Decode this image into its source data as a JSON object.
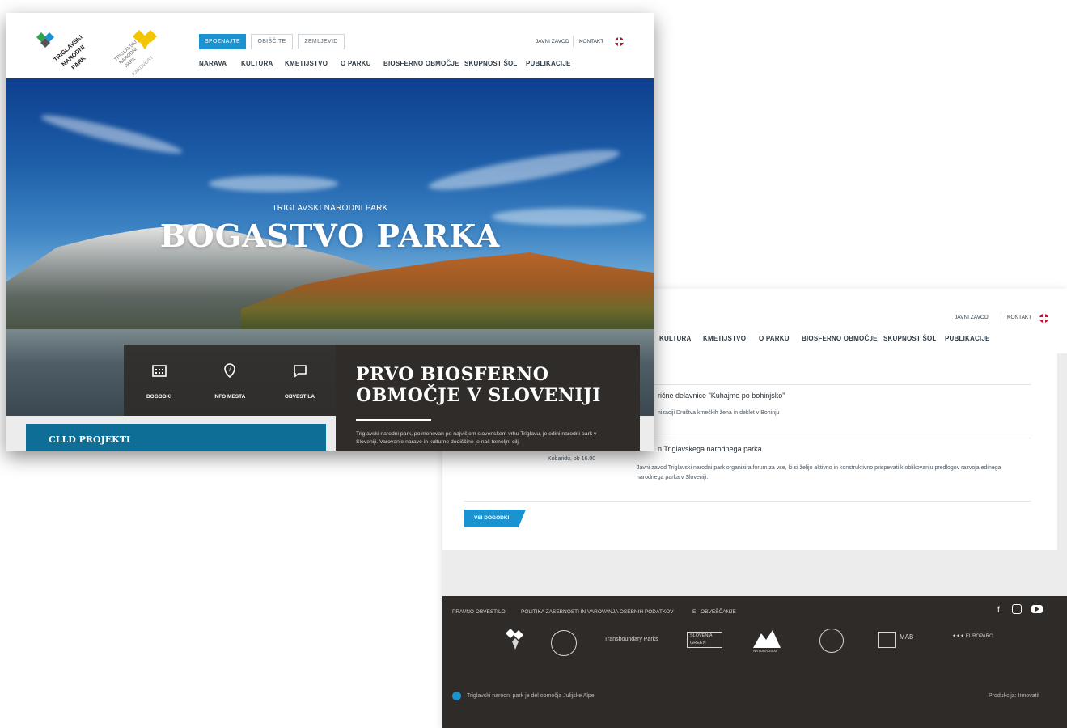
{
  "header": {
    "tabs": [
      "SPOZNAJTE",
      "OBIŠČITE",
      "ZEMLJEVID"
    ],
    "nav": [
      "NARAVA",
      "KULTURA",
      "KMETIJSTVO",
      "O PARKU",
      "BIOSFERNO OBMOČJE",
      "SKUPNOST ŠOL",
      "PUBLIKACIJE"
    ],
    "back_nav": [
      "KULTURA",
      "KMETIJSTVO",
      "O PARKU",
      "BIOSFERNO OBMOČJE",
      "SKUPNOST ŠOL",
      "PUBLIKACIJE"
    ],
    "top_links": [
      "JAVNI ZAVOD",
      "KONTAKT"
    ],
    "logo_lines": [
      "TRIGLAVSKI",
      "NARODNI",
      "PARK"
    ],
    "logo2_lines": [
      "TRIGLAVSKI",
      "NARODNI",
      "PARK",
      "KAKOVOST"
    ]
  },
  "hero": {
    "subtitle": "TRIGLAVSKI NARODNI PARK",
    "title": "BOGASTVO PARKA"
  },
  "quick_links": [
    {
      "label": "DOGODKI",
      "icon": "calendar-icon"
    },
    {
      "label": "INFO MESTA",
      "icon": "location-pin-icon"
    },
    {
      "label": "OBVESTILA",
      "icon": "speech-bubble-icon"
    }
  ],
  "feature": {
    "title": "PRVO BIOSFERNO OBMOČJE V SLOVENIJI",
    "text": "Triglavski narodni park, poimenovan po najvišjem slovenskem vrhu Triglavu, je edini narodni park v Sloveniji. Varovanje narave in kulturne dediščine je naš temeljni cilj."
  },
  "clld": {
    "label": "CLLD PROJEKTI"
  },
  "events": {
    "items": [
      {
        "title": "rične delavnice \"Kuhajmo po bohinjsko\"",
        "text": "nizaciji Društva kmečkih žena in deklet v Bohinju"
      },
      {
        "title": "n Triglavskega narodnega parka",
        "date": "Kobaridu, ob 16.00",
        "text": "Javni zavod Triglavski narodni park organizira forum za vse, ki si želijo aktivno in konstruktivno prispevati k oblikovanju predlogov razvoja edinega narodnega parka v Sloveniji."
      }
    ],
    "all_label": "VSI DOGODKI"
  },
  "footer": {
    "links": [
      "PRAVNO OBVESTILO",
      "POLITIKA ZASEBNOSTI IN VAROVANJA OSEBNIH PODATKOV",
      "E - OBVEŠČANJE"
    ],
    "social": [
      "facebook-icon",
      "instagram-icon",
      "youtube-icon"
    ],
    "partners": [
      "Transboundary Parks",
      "SLOVENIA GREEN",
      "NATURA 2000",
      "MAB",
      "EUROPARC"
    ],
    "bottom_left": "Triglavski narodni park je del območja Julijske Alpe",
    "bottom_right": "Produkcija: Innovatif"
  },
  "colors": {
    "accent": "#1b93d1",
    "dark": "#2f2c2a",
    "clld": "#0e6e95"
  }
}
